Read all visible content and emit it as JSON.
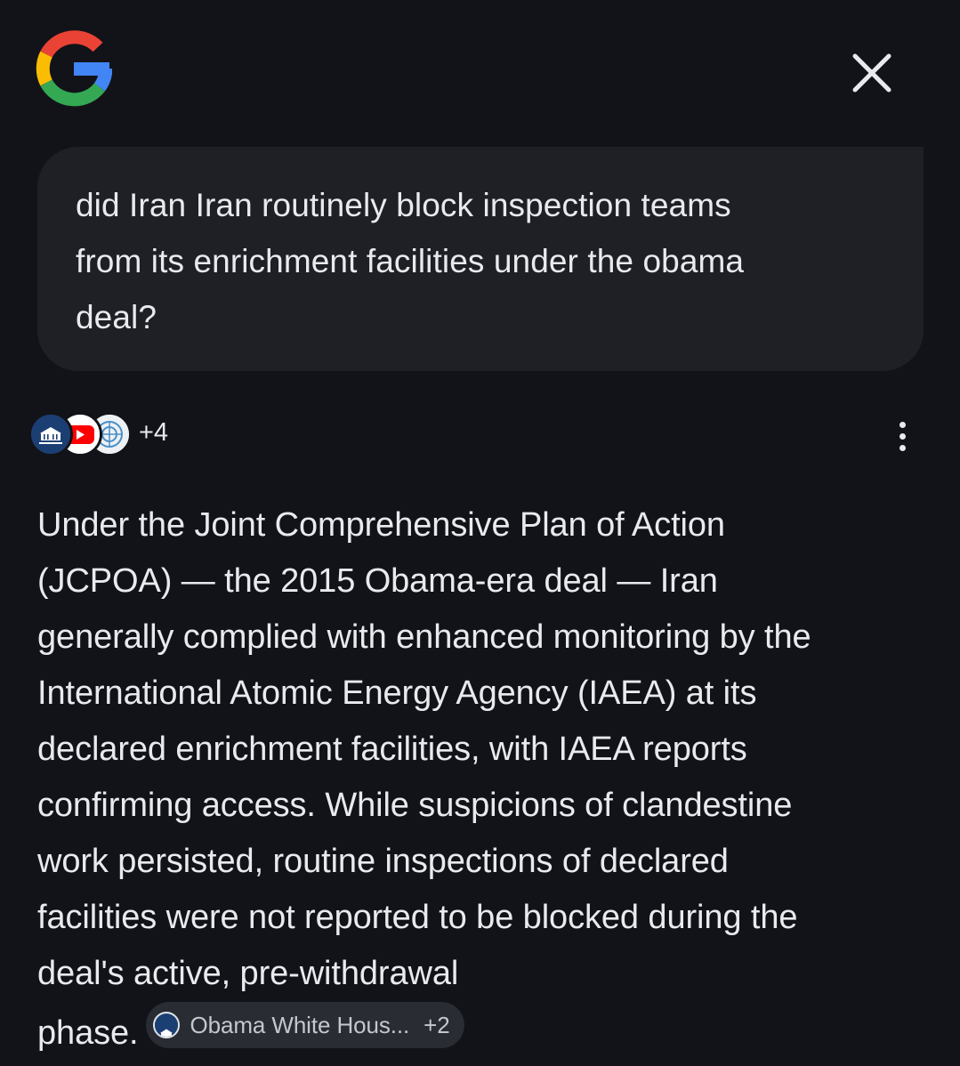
{
  "header": {
    "logo": "google-g-logo",
    "close_icon": "close-icon"
  },
  "query": {
    "lines": [
      "did Iran Iran routinely block inspection teams",
      "from its enrichment facilities under the obama",
      "deal?"
    ]
  },
  "sources": {
    "favicons": [
      "whitehouse-favicon",
      "youtube-favicon",
      "un-favicon"
    ],
    "count": "+4",
    "more_icon": "more-vert-icon"
  },
  "answer": {
    "lines": [
      "Under the Joint Comprehensive Plan of Action",
      "(JCPOA) — the 2015 Obama-era deal — Iran",
      "generally complied with enhanced monitoring by the",
      "International Atomic Energy Agency (IAEA) at its",
      "declared enrichment facilities, with IAEA reports",
      "confirming access. While suspicions of clandestine",
      "work persisted, routine inspections of declared",
      "facilities were not reported to be blocked during the",
      "deal's active, pre-withdrawal",
      "phase."
    ],
    "citation": {
      "label": "Obama White Hous...",
      "more": "+2"
    }
  },
  "colors": {
    "background": "#121318",
    "bubble": "#1f2026",
    "text": "#e8eaed",
    "chip": "#2a2c33"
  }
}
